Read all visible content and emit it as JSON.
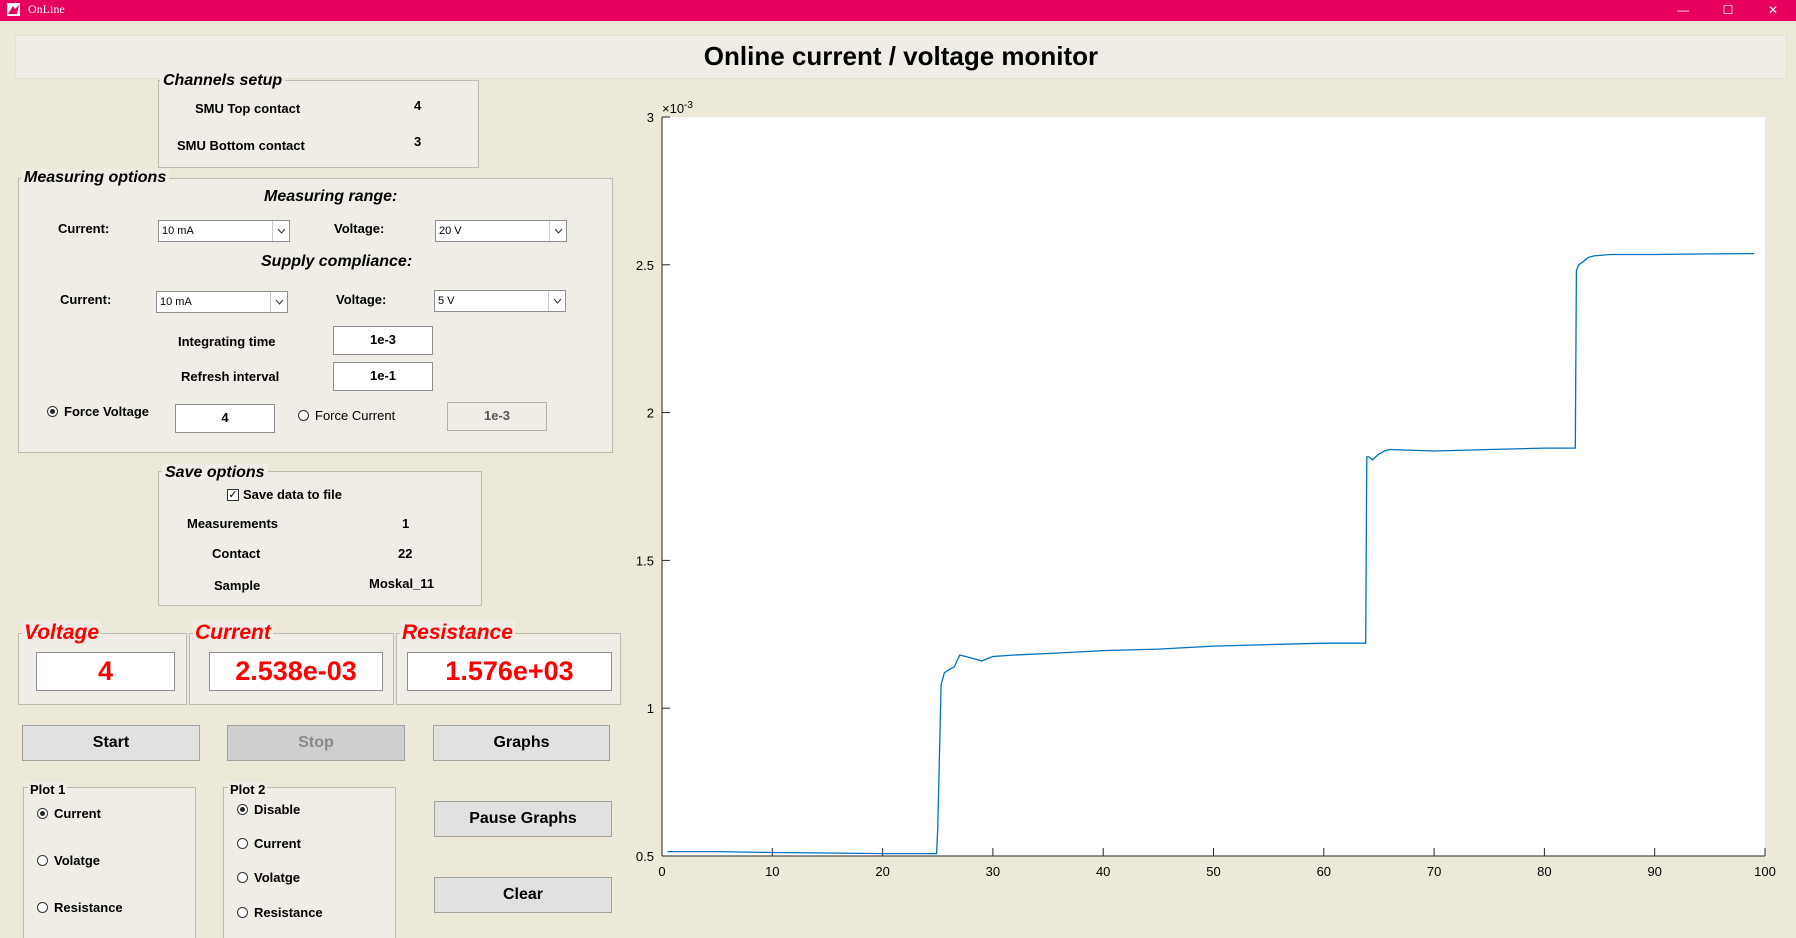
{
  "window": {
    "title": "OnLine"
  },
  "page_title": "Online current / voltage monitor",
  "channels": {
    "title": "Channels setup",
    "top_label": "SMU Top contact",
    "top_value": "4",
    "bottom_label": "SMU Bottom contact",
    "bottom_value": "3"
  },
  "measuring": {
    "title": "Measuring options",
    "range_heading": "Measuring range:",
    "current_label": "Current:",
    "current_value": "10 mA",
    "voltage_label": "Voltage:",
    "voltage_value": "20 V",
    "compliance_heading": "Supply compliance:",
    "comp_current_label": "Current:",
    "comp_current_value": "10 mA",
    "comp_voltage_label": "Voltage:",
    "comp_voltage_value": "5 V",
    "integrating_label": "Integrating time",
    "integrating_value": "1e-3",
    "refresh_label": "Refresh interval",
    "refresh_value": "1e-1",
    "force_voltage_label": "Force Voltage",
    "force_voltage_value": "4",
    "force_current_label": "Force Current",
    "force_current_value": "1e-3"
  },
  "save": {
    "title": "Save options",
    "checkbox_label": "Save data to file",
    "measurements_label": "Measurements",
    "measurements_value": "1",
    "contact_label": "Contact",
    "contact_value": "22",
    "sample_label": "Sample",
    "sample_value": "Moskal_11"
  },
  "readouts": {
    "voltage_label": "Voltage",
    "voltage_value": "4",
    "current_label": "Current",
    "current_value": "2.538e-03",
    "resistance_label": "Resistance",
    "resistance_value": "1.576e+03"
  },
  "buttons": {
    "start": "Start",
    "stop": "Stop",
    "graphs": "Graphs",
    "pause": "Pause Graphs",
    "clear": "Clear"
  },
  "plot1": {
    "title": "Plot 1",
    "options": [
      "Current",
      "Volatge",
      "Resistance"
    ],
    "selected": "Current"
  },
  "plot2": {
    "title": "Plot 2",
    "options": [
      "Disable",
      "Current",
      "Volatge",
      "Resistance"
    ],
    "selected": "Disable"
  },
  "colors": {
    "titlebar": "#e8005e",
    "readout_red": "#ff0000",
    "line": "#0072bd"
  },
  "chart_data": {
    "type": "line",
    "title": "",
    "xlabel": "",
    "ylabel": "",
    "y_exponent_label": "×10",
    "y_exponent": "-3",
    "xlim": [
      0,
      100
    ],
    "ylim": [
      0.5,
      3
    ],
    "x_ticks": [
      0,
      10,
      20,
      30,
      40,
      50,
      60,
      70,
      80,
      90,
      100
    ],
    "y_ticks": [
      0.5,
      1,
      1.5,
      2,
      2.5,
      3
    ],
    "x_tick_labels": [
      "0",
      "10",
      "20",
      "30",
      "40",
      "50",
      "60",
      "70",
      "80",
      "90",
      "100"
    ],
    "y_tick_labels": [
      "0.5",
      "1",
      "1.5",
      "2",
      "2.5",
      "3"
    ],
    "series": [
      {
        "x": [
          0.5,
          5,
          10,
          15,
          20,
          24.9,
          25.0,
          25.3,
          25.6,
          26.0,
          26.5,
          27,
          28,
          29,
          30,
          32,
          35,
          40,
          45,
          50,
          55,
          60,
          63.8,
          63.9,
          64.1,
          64.4,
          65,
          65.5,
          66,
          70,
          75,
          80,
          82.8,
          82.9,
          83.1,
          83.5,
          84,
          84.5,
          86,
          90,
          95,
          99
        ],
        "y": [
          0.515,
          0.515,
          0.512,
          0.51,
          0.508,
          0.508,
          0.6,
          1.08,
          1.12,
          1.13,
          1.14,
          1.18,
          1.17,
          1.16,
          1.175,
          1.18,
          1.185,
          1.195,
          1.2,
          1.21,
          1.215,
          1.22,
          1.22,
          1.85,
          1.85,
          1.84,
          1.86,
          1.87,
          1.875,
          1.87,
          1.875,
          1.88,
          1.88,
          2.48,
          2.5,
          2.51,
          2.525,
          2.53,
          2.535,
          2.535,
          2.537,
          2.538
        ]
      }
    ]
  }
}
